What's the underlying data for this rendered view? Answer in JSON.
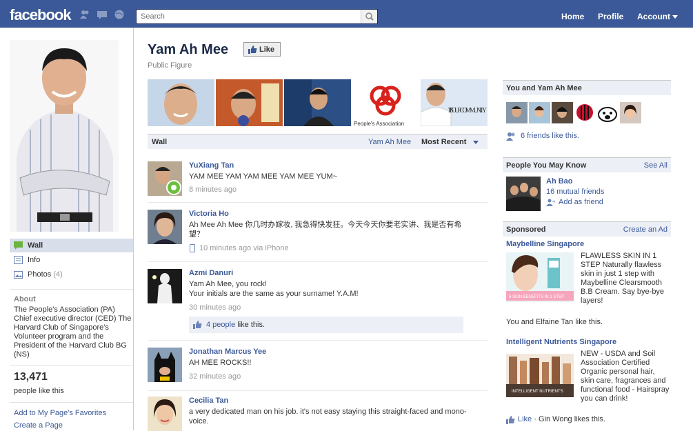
{
  "topbar": {
    "logo": "facebook",
    "search_placeholder": "Search",
    "nav": [
      "Home",
      "Profile",
      "Account"
    ]
  },
  "left": {
    "nav": [
      {
        "label": "Wall",
        "count": ""
      },
      {
        "label": "Info",
        "count": ""
      },
      {
        "label": "Photos",
        "count": "(4)"
      }
    ],
    "about_heading": "About",
    "about_text": "The People's Association (PA) Chief executive director (CED) The Harvard Club of Singapore's Volunteer program and the President of the Harvard Club BG (NS)",
    "likes_count": "13,471",
    "likes_label": "people like this",
    "links": [
      "Add to My Page's Favorites",
      "Create a Page"
    ]
  },
  "header": {
    "title": "Yam Ah Mee",
    "like_label": "Like",
    "category": "Public Figure"
  },
  "photos": {
    "photo5_caption": "IT'S OUR COMMUNITY",
    "photo4_caption": "People's Association"
  },
  "wall": {
    "label": "Wall",
    "filter_name": "Yam Ah Mee",
    "filter_sort": "Most Recent"
  },
  "posts": [
    {
      "name": "YuXiang Tan",
      "text": "YAM MEE YAM YAM MEE YAM MEE YUM~",
      "time": "8 minutes ago"
    },
    {
      "name": "Victoria Ho",
      "text": "Ah Mee Ah Mee 你几时办嫁妆, 我急得快发狂。今天今天你要老实讲、我是否有希望？",
      "time": "10 minutes ago via iPhone"
    },
    {
      "name": "Azmi Danuri",
      "text": "Yam Ah Mee, you rock!\nYour initials are the same as your surname! Y.A.M!",
      "time": "30 minutes ago",
      "likes_link": "4 people",
      "likes_suffix": " like this."
    },
    {
      "name": "Jonathan Marcus Yee",
      "text": "AH MEE ROCKS!!",
      "time": "32 minutes ago"
    },
    {
      "name": "Cecilia Tan",
      "text": "a very dedicated man on his job. it's not easy staying this straight-faced and mono-voice.",
      "time": ""
    }
  ],
  "right": {
    "friends_heading": "You and Yam Ah Mee",
    "friends_like": "6 friends like this.",
    "pymk_heading": "People You May Know",
    "pymk_action": "See All",
    "pymk_name": "Ah Bao",
    "pymk_mutual": "16 mutual friends",
    "pymk_add": "Add as friend",
    "sponsored_heading": "Sponsored",
    "sponsored_action": "Create an Ad",
    "ads": [
      {
        "title": "Maybelline Singapore",
        "body": "FLAWLESS SKIN IN 1 STEP Naturally flawless skin in just 1 step with Maybelline Clearsmooth B.B Cream. Say bye-bye layers!",
        "social": "You and Elfaine Tan like this.",
        "img_text": "6 SKIN BENEFITS IN 1 STEP"
      },
      {
        "title": "Intelligent Nutrients Singapore",
        "body": "NEW - USDA and Soil Association Certified Organic personal hair, skin care, fragrances and functional food - Hairspray you can drink!",
        "like": "Like",
        "social": " · Gin Wong likes this.",
        "img_text": "INTELLIGENT NUTRIENTS"
      }
    ]
  },
  "colors": {
    "brand": "#3b5998",
    "link": "#3b5998",
    "header_bg": "#eceff5"
  }
}
